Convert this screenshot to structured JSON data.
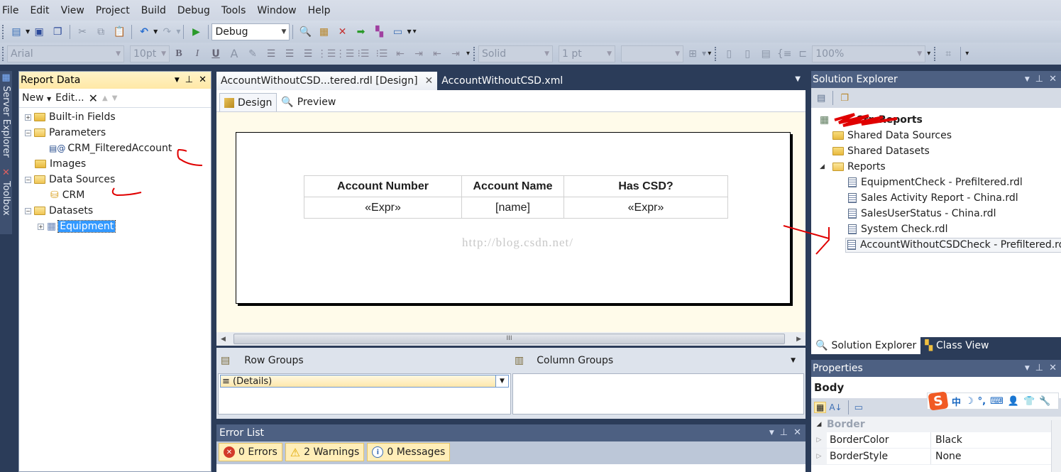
{
  "menu": [
    "File",
    "Edit",
    "View",
    "Project",
    "Build",
    "Debug",
    "Tools",
    "Window",
    "Help"
  ],
  "toolbar1": {
    "solution_config": "Debug",
    "icons": [
      "new-project-icon",
      "save-icon",
      "save-all-icon",
      "cut-icon",
      "copy-icon",
      "paste-icon",
      "undo-icon",
      "redo-icon",
      "start-debug-icon",
      "find-in-files-icon",
      "properties-icon",
      "toolbox-icon",
      "solution-explorer-icon",
      "class-view-icon",
      "command-window-icon"
    ]
  },
  "toolbar2": {
    "font_family": "Arial",
    "font_size": "10pt",
    "border_style": "Solid",
    "border_width": "1 pt",
    "border_color": "",
    "zoom": "100%",
    "format_labels": {
      "bold": "B",
      "italic": "I",
      "underline": "U",
      "font_color": "A"
    }
  },
  "left_strip": {
    "tabs": [
      "Server Explorer",
      "Toolbox"
    ]
  },
  "report_data": {
    "title": "Report Data",
    "toolbar": {
      "new_label": "New",
      "edit_label": "Edit...",
      "delete_label": "✕"
    },
    "tree": [
      {
        "label": "Built-in Fields",
        "type": "folder",
        "expander": "+",
        "level": 0
      },
      {
        "label": "Parameters",
        "type": "folder-open",
        "expander": "−",
        "level": 0
      },
      {
        "label": "CRM_FilteredAccount",
        "type": "parameter",
        "level": 1
      },
      {
        "label": "Images",
        "type": "folder",
        "level": 0
      },
      {
        "label": "Data Sources",
        "type": "folder-open",
        "expander": "−",
        "level": 0
      },
      {
        "label": "CRM",
        "type": "datasource",
        "level": 1
      },
      {
        "label": "Datasets",
        "type": "folder-open",
        "expander": "−",
        "level": 0
      },
      {
        "label": "Equipment",
        "type": "dataset",
        "expander": "+",
        "level": 1,
        "selected": true
      }
    ]
  },
  "doc_tabs": [
    {
      "label": "AccountWithoutCSD...tered.rdl [Design]",
      "active": true,
      "close": "✕"
    },
    {
      "label": "AccountWithoutCSD.xml",
      "active": false
    }
  ],
  "sub_tabs": [
    {
      "label": "Design",
      "active": true
    },
    {
      "label": "Preview",
      "active": false
    }
  ],
  "report_table": {
    "headers": [
      "Account Number",
      "Account Name",
      "Has CSD?"
    ],
    "row": [
      "«Expr»",
      "[name]",
      "«Expr»"
    ]
  },
  "watermark": "http://blog.csdn.net/",
  "hscroll_grip": "III",
  "groups": {
    "row_groups_label": "Row Groups",
    "column_groups_label": "Column Groups",
    "details": "≡ (Details)"
  },
  "error_list": {
    "title": "Error List",
    "errors": "0 Errors",
    "warnings": "2 Warnings",
    "messages": "0 Messages"
  },
  "solution_explorer": {
    "title": "Solution Explorer",
    "project": "CrmReports",
    "items": [
      {
        "label": "Shared Data Sources",
        "type": "folder",
        "level": 1
      },
      {
        "label": "Shared Datasets",
        "type": "folder",
        "level": 1
      },
      {
        "label": "Reports",
        "type": "folder-open",
        "level": 1,
        "expander": "◢"
      },
      {
        "label": "EquipmentCheck - Prefiltered.rdl",
        "type": "report",
        "level": 2
      },
      {
        "label": "Sales Activity Report - China.rdl",
        "type": "report",
        "level": 2
      },
      {
        "label": "SalesUserStatus - China.rdl",
        "type": "report",
        "level": 2
      },
      {
        "label": "System Check.rdl",
        "type": "report",
        "level": 2
      },
      {
        "label": "AccountWithoutCSDCheck - Prefiltered.rdl",
        "type": "report",
        "level": 2,
        "selected": true
      }
    ]
  },
  "bottom_tabs": [
    {
      "label": "Solution Explorer",
      "active": true
    },
    {
      "label": "Class View",
      "active": false
    }
  ],
  "properties": {
    "title": "Properties",
    "object": "Body",
    "category": "Border",
    "rows": [
      {
        "name": "BorderColor",
        "value": "Black"
      },
      {
        "name": "BorderStyle",
        "value": "None"
      }
    ]
  },
  "ime_bar": {
    "logo": "S",
    "items": [
      "中",
      "☽",
      "°,",
      "⌨",
      "👤",
      "👕",
      "🔧"
    ]
  },
  "colors": {
    "chrome_dark": "#2b3c59",
    "panel_title_inactive": "#4d6082",
    "panel_title_active": "#ffe8a6",
    "selection": "#3399ff",
    "design_canvas": "#fffbea",
    "annotation_red": "#e00000"
  }
}
